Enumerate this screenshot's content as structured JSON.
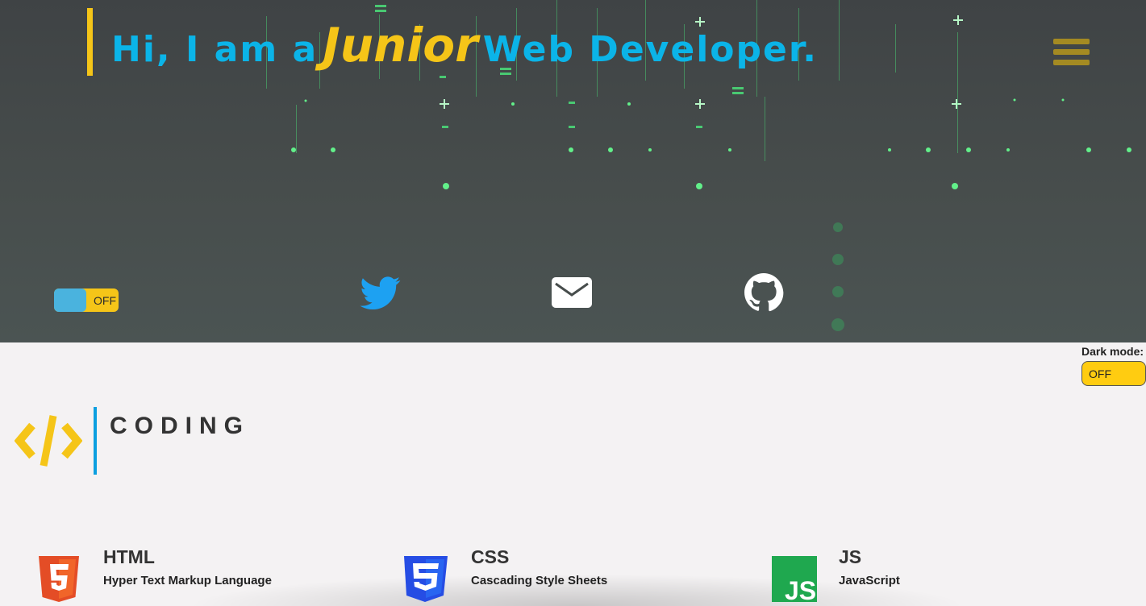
{
  "hero": {
    "title_prefix": "Hi, I am a",
    "title_accent": "Junior",
    "title_suffix": "Web Developer.",
    "toggle_label": "OFF"
  },
  "menu": {
    "icon": "hamburger-menu-icon"
  },
  "social": [
    {
      "name": "twitter",
      "icon": "twitter-icon",
      "color": "#1da1f2"
    },
    {
      "name": "email",
      "icon": "envelope-icon",
      "color": "#ffffff"
    },
    {
      "name": "github",
      "icon": "github-icon",
      "color": "#ffffff"
    }
  ],
  "dark_mode": {
    "label": "Dark mode:",
    "selected": "OFF"
  },
  "coding": {
    "title": "CODING",
    "icon": "code-brackets-icon"
  },
  "skills": [
    {
      "name": "HTML",
      "desc": "Hyper Text Markup Language",
      "icon": "html5-icon",
      "color": "#e44d26"
    },
    {
      "name": "CSS",
      "desc": "Cascading Style Sheets",
      "icon": "css3-icon",
      "color": "#264de4"
    },
    {
      "name": "JS",
      "desc": "JavaScript",
      "icon": "javascript-icon",
      "color": "#1fa84f"
    }
  ],
  "colors": {
    "accent_yellow": "#f5c518",
    "accent_blue": "#0bb4e8",
    "matrix_green": "#4be07a"
  }
}
